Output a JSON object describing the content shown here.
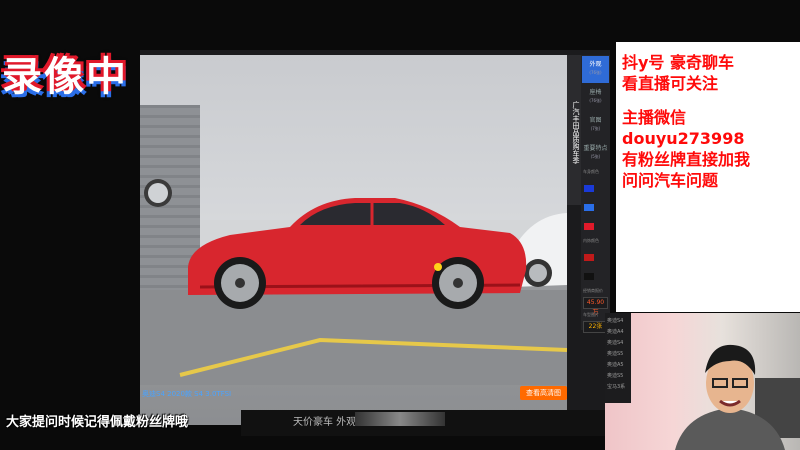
{
  "overlay": {
    "recording_label": "录像中",
    "subtitle": "大家提问时候记得佩戴粉丝牌哦"
  },
  "viewer": {
    "caption": "奥迪S4  2020款 S4 3.0TFSI",
    "hd_button": "查看高清图",
    "side_title": "广汽丰田品质购车季",
    "tabs": [
      {
        "label": "外观",
        "count": "(76张)"
      },
      {
        "label": "座椅",
        "count": "(76张)"
      },
      {
        "label": "官图",
        "count": "(7张)"
      },
      {
        "label": "重要特点",
        "count": "(5张)"
      }
    ],
    "color_label": "车身颜色",
    "interior_label": "内饰颜色",
    "price_label": "经销商报价",
    "price": "45.90万",
    "series_label": "车型图片",
    "series_count": "22张",
    "bottom_text": "天价豪车 外观已曝光",
    "colors": {
      "accent": "#ff6a00",
      "active_tab": "#2f6bd6",
      "price": "#ff5a2a",
      "car": "#d8262e"
    }
  },
  "info_panel": {
    "lines": [
      "抖y号  豪奇聊车",
      "看直播可关注"
    ],
    "lines2": [
      "主播微信",
      "douyu273998",
      "有粉丝牌直接加我",
      "问问汽车问题"
    ],
    "text_color": "#ff0a0a"
  },
  "cam": {
    "list_items": [
      "奥迪S4",
      "奥迪A4",
      "奥迪S4",
      "奥迪S5",
      "奥迪A5",
      "奥迪S5",
      "宝马3系"
    ]
  }
}
